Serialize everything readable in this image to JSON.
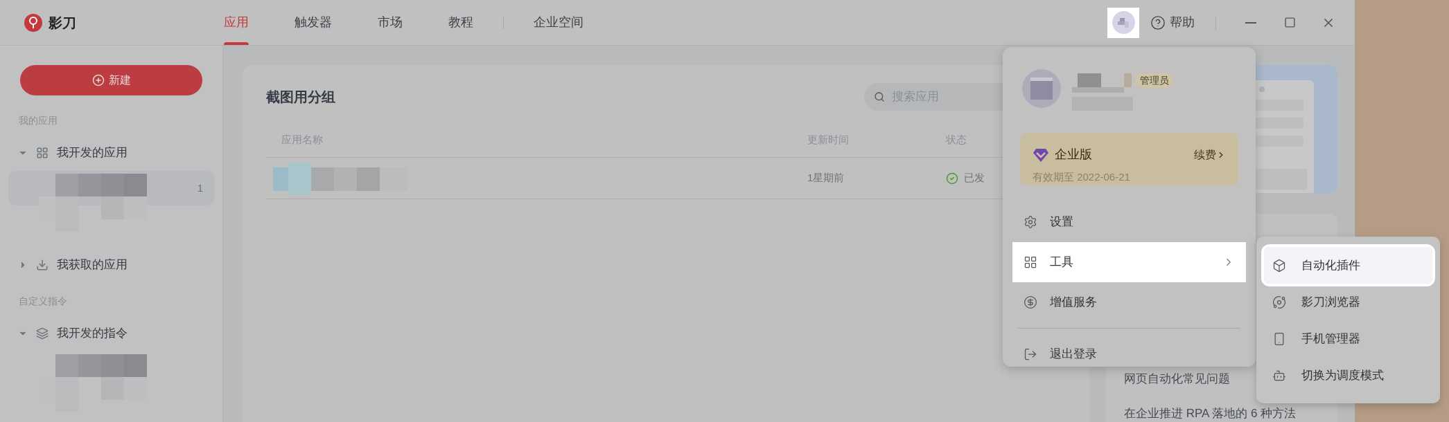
{
  "app": {
    "name": "影刀"
  },
  "nav_tabs": [
    {
      "label": "应用",
      "selected": true
    },
    {
      "label": "触发器",
      "selected": false
    },
    {
      "label": "市场",
      "selected": false
    },
    {
      "label": "教程",
      "selected": false
    },
    {
      "label": "企业空间",
      "selected": false
    }
  ],
  "header": {
    "help": "帮助"
  },
  "sidebar": {
    "new_button": "新建",
    "sections": [
      {
        "title": "我的应用",
        "groups": [
          {
            "label": "我开发的应用",
            "expanded": true,
            "items": [
              {
                "kind": "redacted",
                "count": "1",
                "selected": true
              }
            ]
          },
          {
            "label": "我获取的应用",
            "expanded": false
          }
        ]
      },
      {
        "title": "自定义指令",
        "groups": [
          {
            "label": "我开发的指令",
            "expanded": true,
            "items": [
              {
                "kind": "redacted",
                "selected": false
              }
            ]
          }
        ]
      }
    ]
  },
  "main": {
    "title": "截图用分组",
    "search": {
      "placeholder": "搜索应用"
    },
    "table": {
      "columns": [
        "应用名称",
        "更新时间",
        "状态"
      ],
      "rows": [
        {
          "updated": "1星期前",
          "status": "已发",
          "published": true
        }
      ]
    }
  },
  "side_panel": {
    "articles": [
      "网页自动化常见问题",
      "在企业推进 RPA 落地的 6 种方法"
    ]
  },
  "user_menu": {
    "role_badge": "管理员",
    "plan": {
      "name": "企业版",
      "renew": "续费",
      "expiry": "有效期至 2022-06-21"
    },
    "items": [
      {
        "label": "设置",
        "selected": false,
        "has_submenu": false
      },
      {
        "label": "工具",
        "selected": true,
        "has_submenu": true
      },
      {
        "label": "增值服务",
        "selected": false,
        "has_submenu": false
      },
      {
        "label": "退出登录",
        "selected": false,
        "has_submenu": false
      }
    ],
    "submenu": [
      {
        "label": "自动化插件",
        "selected": true
      },
      {
        "label": "影刀浏览器",
        "selected": false
      },
      {
        "label": "手机管理器",
        "selected": false
      },
      {
        "label": "切换为调度模式",
        "selected": false
      }
    ]
  }
}
